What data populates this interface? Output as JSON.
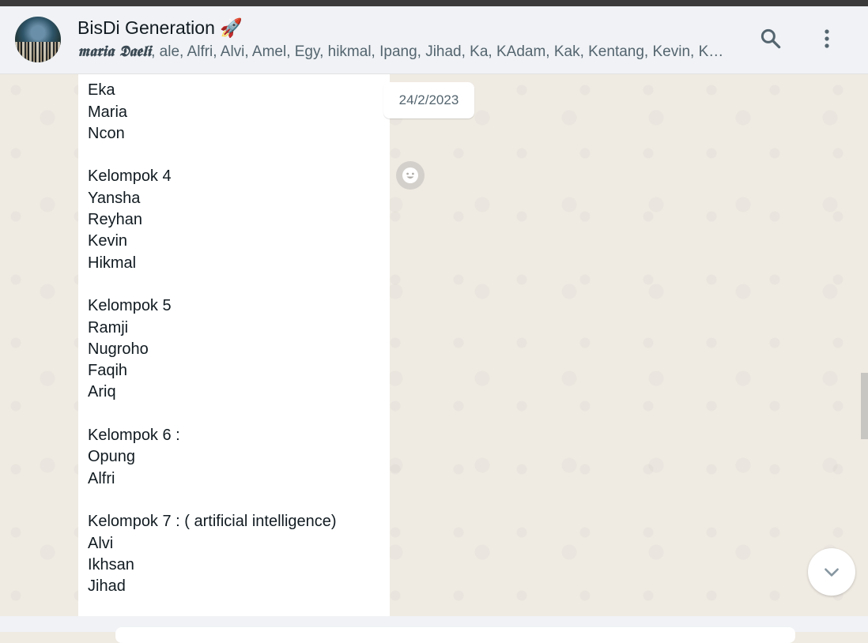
{
  "header": {
    "title": "BisDi Generation",
    "title_emoji": "🚀",
    "members_bold": "𝖒𝖆𝖗𝖎𝖆 𝕯𝖆𝖊𝖑𝖎",
    "members_rest": ", ale, Alfri, Alvi, Amel, Egy, hikmal, Ipang, Jihad, Ka, KAdam, Kak, Kentang, Kevin, KFit, K...",
    "search_icon": "search-icon",
    "menu_icon": "more-vertical-icon"
  },
  "chat": {
    "date_chip": "24/2/2023",
    "message_text": "Ale\nEka\nMaria\nNcon\n\nKelompok 4\nYansha\nReyhan\nKevin\nHikmal\n\nKelompok 5\nRamji\nNugroho\nFaqih\nAriq\n\nKelompok 6 :\nOpung\nAlfri\n\nKelompok 7 : ( artificial intelligence)\nAlvi\nIkhsan\nJihad",
    "emoji_icon": "emoji-reaction-icon",
    "scroll_down_icon": "chevron-down-icon"
  },
  "colors": {
    "header_bg": "#f0f2f5",
    "chat_bg": "#efeae2",
    "bubble_bg": "#ffffff",
    "text_primary": "#111b21",
    "text_secondary": "#54656f"
  }
}
